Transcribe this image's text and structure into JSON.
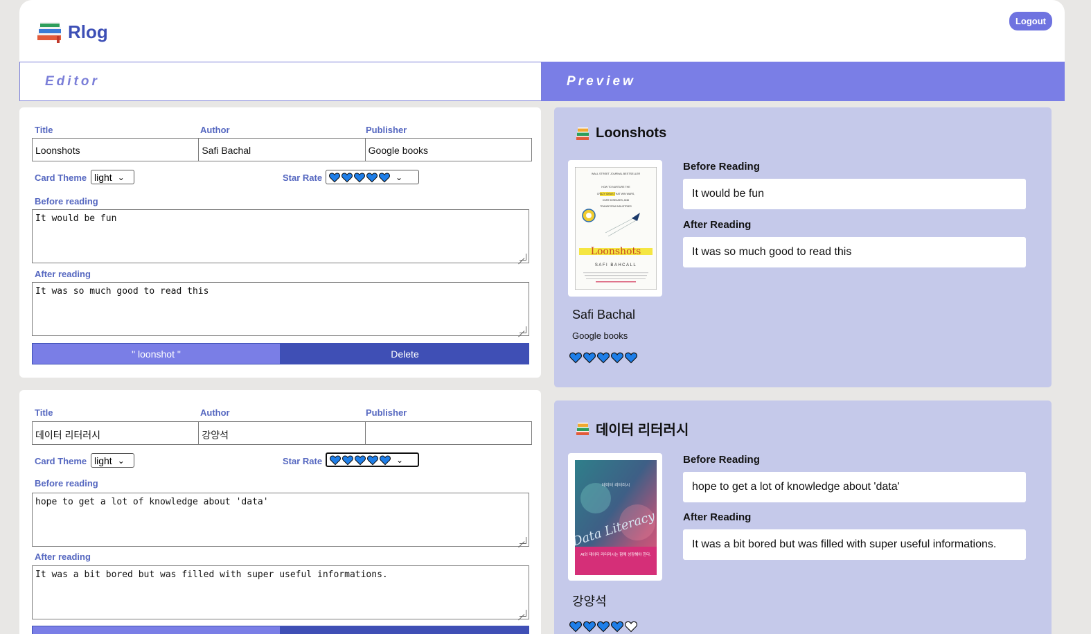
{
  "app": {
    "name": "Rlog",
    "logout_label": "Logout"
  },
  "tabs": {
    "editor": "Editor",
    "preview": "Preview"
  },
  "labels": {
    "title": "Title",
    "author": "Author",
    "publisher": "Publisher",
    "card_theme": "Card Theme",
    "star_rate": "Star Rate",
    "before_reading": "Before reading",
    "after_reading": "After reading",
    "pv_before": "Before Reading",
    "pv_after": "After Reading",
    "delete": "Delete"
  },
  "cards": [
    {
      "title": "Loonshots",
      "author": "Safi Bachal",
      "publisher": "Google books",
      "theme": "light",
      "stars": 5,
      "before": "It would be fun",
      "after": "It was so much good to read this",
      "file_button": "\" loonshot \"",
      "cover": {
        "kicker": "WALL STREET JOURNAL BESTSELLER",
        "subtitle": "HOW TO NURTURE THE CRAZY IDEAS THAT WIN WARS, CURE DISEASES, AND TRANSFORM INDUSTRIES",
        "title": "Loonshots",
        "author": "SAFI BAHCALL"
      }
    },
    {
      "title": "데이터 리터러시",
      "author": "강양석",
      "publisher": "",
      "theme": "light",
      "stars": 4,
      "before": "hope to get a lot of knowledge about 'data'",
      "after": "It was a bit bored but was filled with super useful informations.",
      "cover": {
        "top": "데이터 리터러시",
        "script": "Data Literacy",
        "band": "AI와 데이터 리터러시는 함께 성장해야 한다."
      }
    }
  ],
  "colors": {
    "accent": "#7a7ee6",
    "dark_accent": "#3f4fb5",
    "preview_bg": "#c5c9ea",
    "heart": "#1e7ee8"
  }
}
